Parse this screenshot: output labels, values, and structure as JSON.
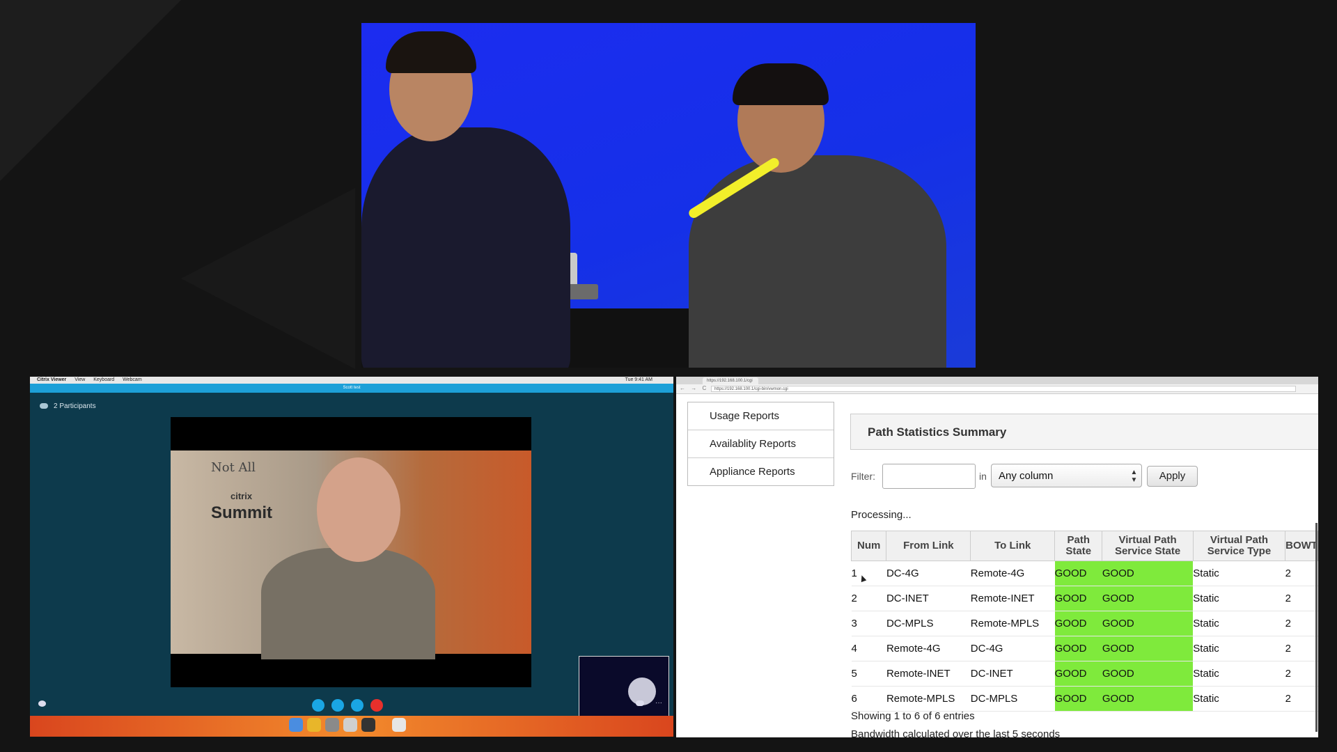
{
  "viewer": {
    "menubar": [
      "Citrix Viewer",
      "View",
      "Keyboard",
      "Webcam"
    ],
    "menubar_time": "Tue 9:41 AM",
    "call_title": "Scott test",
    "participants_label": "2 Participants",
    "sign_note": "Not All",
    "sign_brand": "citrix",
    "sign_event": "Summit",
    "call_controls": [
      {
        "name": "video-icon",
        "color": "#1aa6e4"
      },
      {
        "name": "mic-icon",
        "color": "#1aa6e4"
      },
      {
        "name": "screen-share-icon",
        "color": "#1aa6e4"
      },
      {
        "name": "hang-up-icon",
        "color": "#e8302c"
      }
    ],
    "more_label": "···"
  },
  "browser": {
    "tab_title": "https://192.168.100.1/cgi",
    "url": "https://192.168.100.1/cgi-bin/vwmon.cgi",
    "nav_glyphs": "← → C",
    "menu": [
      "Usage Reports",
      "Availablity Reports",
      "Appliance Reports"
    ],
    "panel_title": "Path Statistics Summary",
    "filter_label": "Filter:",
    "filter_value": "",
    "in_label": "in",
    "column_select": "Any column",
    "select_arrows": "▲▼",
    "apply_label": "Apply",
    "processing": "Processing...",
    "table": {
      "headers": [
        "Num",
        "From Link",
        "To Link",
        "Path State",
        "Virtual Path Service State",
        "Virtual Path Service Type",
        "BOWT"
      ],
      "rows": [
        [
          "1",
          "DC-4G",
          "Remote-4G",
          "GOOD",
          "GOOD",
          "Static",
          "2"
        ],
        [
          "2",
          "DC-INET",
          "Remote-INET",
          "GOOD",
          "GOOD",
          "Static",
          "2"
        ],
        [
          "3",
          "DC-MPLS",
          "Remote-MPLS",
          "GOOD",
          "GOOD",
          "Static",
          "2"
        ],
        [
          "4",
          "Remote-4G",
          "DC-4G",
          "GOOD",
          "GOOD",
          "Static",
          "2"
        ],
        [
          "5",
          "Remote-INET",
          "DC-INET",
          "GOOD",
          "GOOD",
          "Static",
          "2"
        ],
        [
          "6",
          "Remote-MPLS",
          "DC-MPLS",
          "GOOD",
          "GOOD",
          "Static",
          "2"
        ]
      ]
    },
    "showing": "Showing 1 to 6 of 6 entries",
    "bandwidth_note": "Bandwidth calculated over the last 5 seconds"
  },
  "colors": {
    "good": "#7fea3c",
    "stage_blue": "#1530e8",
    "call_title_blue": "#1da0d8"
  }
}
